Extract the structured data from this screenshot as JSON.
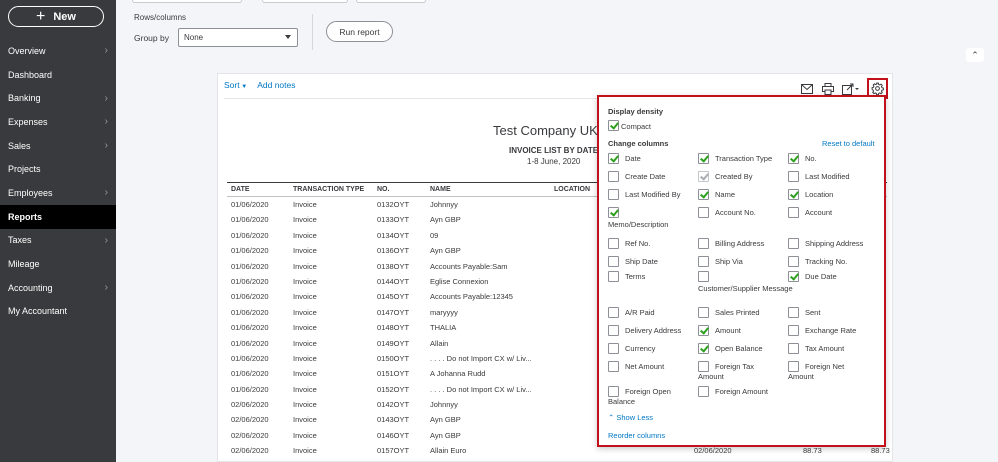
{
  "sidebar": {
    "new_label": "New",
    "items": [
      {
        "label": "Overview",
        "chevron": true,
        "active": false
      },
      {
        "label": "Dashboard",
        "chevron": false,
        "active": false
      },
      {
        "label": "Banking",
        "chevron": true,
        "active": false
      },
      {
        "label": "Expenses",
        "chevron": true,
        "active": false
      },
      {
        "label": "Sales",
        "chevron": true,
        "active": false
      },
      {
        "label": "Projects",
        "chevron": false,
        "active": false
      },
      {
        "label": "Employees",
        "chevron": true,
        "active": false
      },
      {
        "label": "Reports",
        "chevron": false,
        "active": true
      },
      {
        "label": "Taxes",
        "chevron": true,
        "active": false
      },
      {
        "label": "Mileage",
        "chevron": false,
        "active": false
      },
      {
        "label": "Accounting",
        "chevron": true,
        "active": false
      },
      {
        "label": "My Accountant",
        "chevron": false,
        "active": false
      }
    ]
  },
  "filters": {
    "rows_columns_label": "Rows/columns",
    "group_by_label": "Group by",
    "group_by_value": "None",
    "run_report_label": "Run report"
  },
  "report": {
    "sort_label": "Sort",
    "add_notes_label": "Add notes",
    "company": "Test Company UK",
    "title": "INVOICE LIST BY DATE",
    "date_range": "1-8 June, 2020",
    "columns": [
      "DATE",
      "TRANSACTION TYPE",
      "NO.",
      "NAME",
      "LOCATION"
    ],
    "rows": [
      [
        "01/06/2020",
        "Invoice",
        "0132OYT",
        "Johnnyy",
        "",
        "",
        ""
      ],
      [
        "01/06/2020",
        "Invoice",
        "0133OYT",
        "Ayn GBP",
        "",
        "",
        ""
      ],
      [
        "01/06/2020",
        "Invoice",
        "0134OYT",
        "09",
        "",
        "",
        ""
      ],
      [
        "01/06/2020",
        "Invoice",
        "0136OYT",
        "Ayn GBP",
        "",
        "",
        ""
      ],
      [
        "01/06/2020",
        "Invoice",
        "0138OYT",
        "Accounts Payable:Sam",
        "",
        "",
        ""
      ],
      [
        "01/06/2020",
        "Invoice",
        "0144OYT",
        "Eglise Connexion",
        "",
        "",
        ""
      ],
      [
        "01/06/2020",
        "Invoice",
        "0145OYT",
        "Accounts Payable:12345",
        "",
        "",
        ""
      ],
      [
        "01/06/2020",
        "Invoice",
        "0147OYT",
        "maryyyy",
        "",
        "",
        ""
      ],
      [
        "01/06/2020",
        "Invoice",
        "0148OYT",
        "THALIA",
        "",
        "",
        ""
      ],
      [
        "01/06/2020",
        "Invoice",
        "0149OYT",
        "Allain",
        "",
        "",
        ""
      ],
      [
        "01/06/2020",
        "Invoice",
        "0150OYT",
        ". . . . Do not Import CX w/ Liv...",
        "",
        "",
        ""
      ],
      [
        "01/06/2020",
        "Invoice",
        "0151OYT",
        "A Johanna Rudd",
        "",
        "",
        ""
      ],
      [
        "01/06/2020",
        "Invoice",
        "0152OYT",
        ". . . . Do not Import CX w/ Liv...",
        "",
        "",
        ""
      ],
      [
        "02/06/2020",
        "Invoice",
        "0142OYT",
        "Johnnyy",
        "",
        "",
        ""
      ],
      [
        "02/06/2020",
        "Invoice",
        "0143OYT",
        "Ayn GBP",
        "",
        "",
        ""
      ],
      [
        "02/06/2020",
        "Invoice",
        "0146OYT",
        "Ayn GBP",
        "",
        "",
        ""
      ],
      [
        "02/06/2020",
        "Invoice",
        "0157OYT",
        "Allain Euro",
        "",
        "02/06/2020",
        "88.73"
      ]
    ],
    "last_row_extra": "88.73"
  },
  "settings": {
    "display_density_label": "Display density",
    "compact_label": "Compact",
    "change_columns_label": "Change columns",
    "reset_label": "Reset to default",
    "show_less_label": "Show Less",
    "reorder_label": "Reorder columns",
    "options": [
      {
        "label": "Date",
        "checked": true
      },
      {
        "label": "Transaction Type",
        "checked": true
      },
      {
        "label": "No.",
        "checked": true
      },
      {
        "label": "Create Date",
        "checked": false
      },
      {
        "label": "Created By",
        "checked": true,
        "disabled": true
      },
      {
        "label": "Last Modified",
        "checked": false
      },
      {
        "label": "Last Modified By",
        "checked": false
      },
      {
        "label": "Name",
        "checked": true
      },
      {
        "label": "Location",
        "checked": true
      },
      {
        "label": "Memo/Description",
        "checked": true
      },
      {
        "label": "Account No.",
        "checked": false
      },
      {
        "label": "Account",
        "checked": false
      },
      {
        "label": "Ref No.",
        "checked": false
      },
      {
        "label": "Billing Address",
        "checked": false
      },
      {
        "label": "Shipping Address",
        "checked": false
      },
      {
        "label": "Ship Date",
        "checked": false
      },
      {
        "label": "Ship Via",
        "checked": false
      },
      {
        "label": "Tracking No.",
        "checked": false
      },
      {
        "label": "Terms",
        "checked": false
      },
      {
        "label": "Customer/Supplier Message",
        "checked": false
      },
      {
        "label": "Due Date",
        "checked": true
      },
      {
        "label": "A/R Paid",
        "checked": false
      },
      {
        "label": "Sales Printed",
        "checked": false
      },
      {
        "label": "Sent",
        "checked": false
      },
      {
        "label": "Delivery Address",
        "checked": false
      },
      {
        "label": "Amount",
        "checked": true
      },
      {
        "label": "Exchange Rate",
        "checked": false
      },
      {
        "label": "Currency",
        "checked": false
      },
      {
        "label": "Open Balance",
        "checked": true
      },
      {
        "label": "Tax Amount",
        "checked": false
      },
      {
        "label": "Net Amount",
        "checked": false
      },
      {
        "label": "Foreign Tax Amount",
        "checked": false
      },
      {
        "label": "Foreign Net Amount",
        "checked": false
      },
      {
        "label": "Foreign Open Balance",
        "checked": false
      },
      {
        "label": "Foreign Amount",
        "checked": false
      }
    ]
  },
  "colors": {
    "accent_link": "#0077c5",
    "check_green": "#2ca01c",
    "highlight_red": "#c1111b",
    "sidebar_bg": "#393a3d"
  }
}
